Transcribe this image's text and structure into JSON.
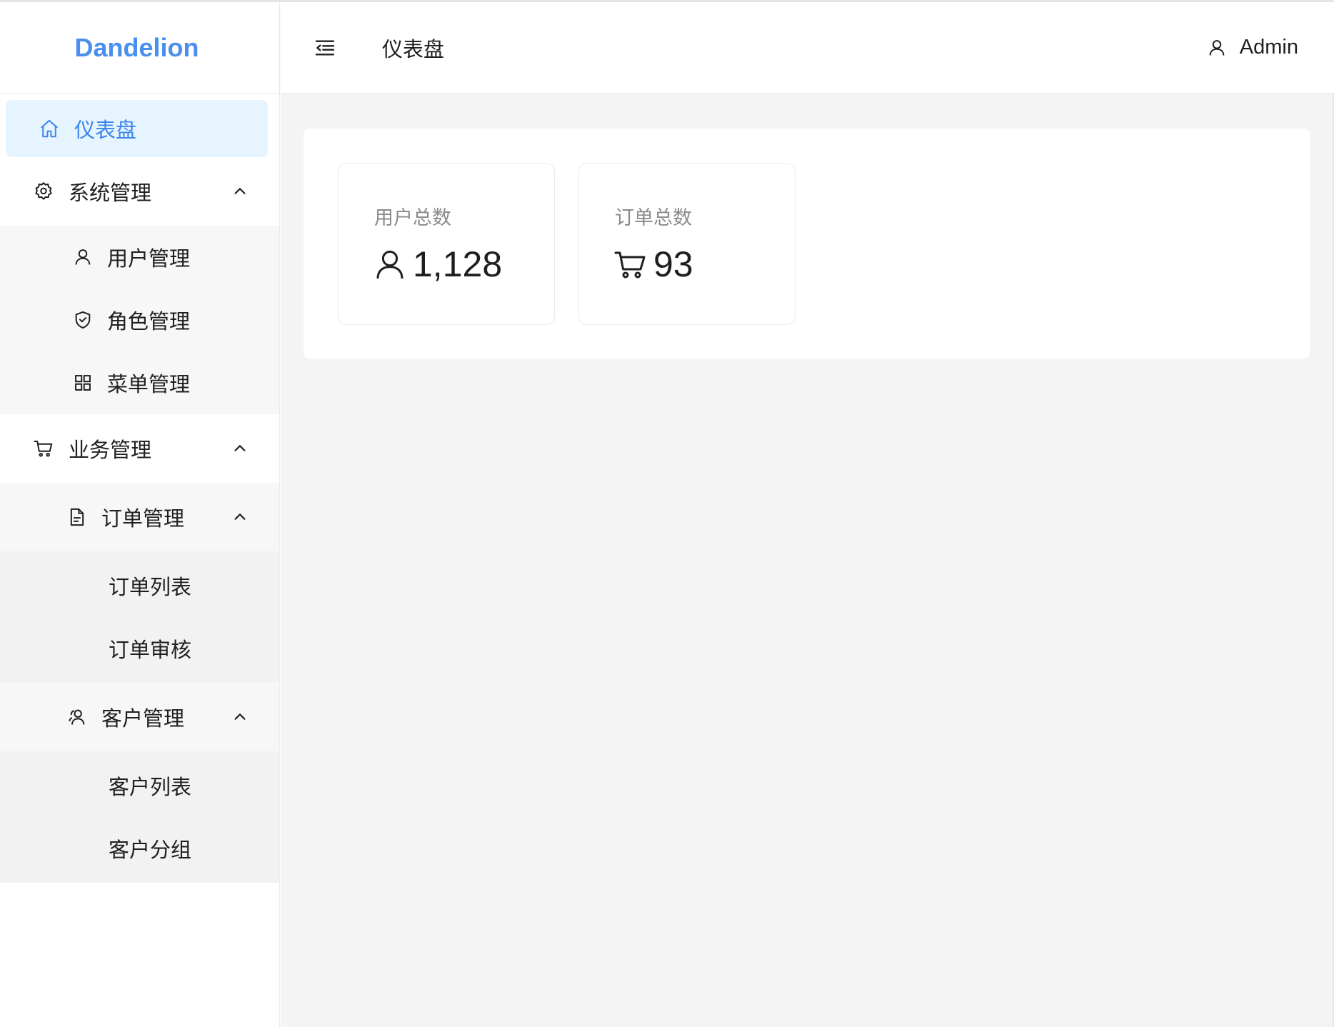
{
  "app": {
    "logo": "Dandelion"
  },
  "header": {
    "title": "仪表盘",
    "user": "Admin"
  },
  "sidebar": {
    "dashboard": "仪表盘",
    "system": {
      "label": "系统管理",
      "items": [
        "用户管理",
        "角色管理",
        "菜单管理"
      ]
    },
    "business": {
      "label": "业务管理",
      "orders": {
        "label": "订单管理",
        "items": [
          "订单列表",
          "订单审核"
        ]
      },
      "customers": {
        "label": "客户管理",
        "items": [
          "客户列表",
          "客户分组"
        ]
      }
    }
  },
  "stats": [
    {
      "label": "用户总数",
      "value": "1,128",
      "icon": "user-icon"
    },
    {
      "label": "订单总数",
      "value": "93",
      "icon": "cart-icon"
    }
  ],
  "colors": {
    "accent": "#3a86ec",
    "active_bg": "#e6f4ff",
    "content_bg": "#f4f4f4"
  }
}
